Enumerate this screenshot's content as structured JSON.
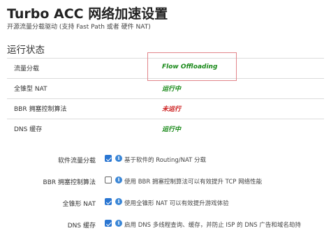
{
  "header": {
    "title": "Turbo ACC 网络加速设置",
    "description": "开源流量分载驱动 (支持 Fast Path 或者 硬件 NAT)"
  },
  "status_section": {
    "title": "运行状态",
    "rows": [
      {
        "label": "流量分载",
        "value": "Flow Offloading",
        "state": "running"
      },
      {
        "label": "全锥型 NAT",
        "value": "运行中",
        "state": "running"
      },
      {
        "label": "BBR 拥塞控制算法",
        "value": "未运行",
        "state": "stopped"
      },
      {
        "label": "DNS 缓存",
        "value": "运行中",
        "state": "running"
      }
    ]
  },
  "config_section": {
    "options": [
      {
        "label": "软件流量分载",
        "checked": true,
        "help": "基于软件的 Routing/NAT 分载"
      },
      {
        "label": "BBR 拥塞控制算法",
        "checked": false,
        "help": "使用 BBR 拥塞控制算法可以有效提升 TCP 网络性能"
      },
      {
        "label": "全锥形 NAT",
        "checked": true,
        "help": "使用全锥形 NAT 可以有效提升游戏体验"
      },
      {
        "label": "DNS 缓存",
        "checked": true,
        "help": "启用 DNS 多线程查询、缓存，并防止 ISP 的 DNS 广告和域名劫持"
      }
    ]
  },
  "colors": {
    "running": "#1a8a1a",
    "stopped": "#cc1a1a",
    "checkbox_accent": "#2a76d2",
    "highlight_border": "#e2848a"
  },
  "icons": {
    "info": "info-circle-icon"
  }
}
